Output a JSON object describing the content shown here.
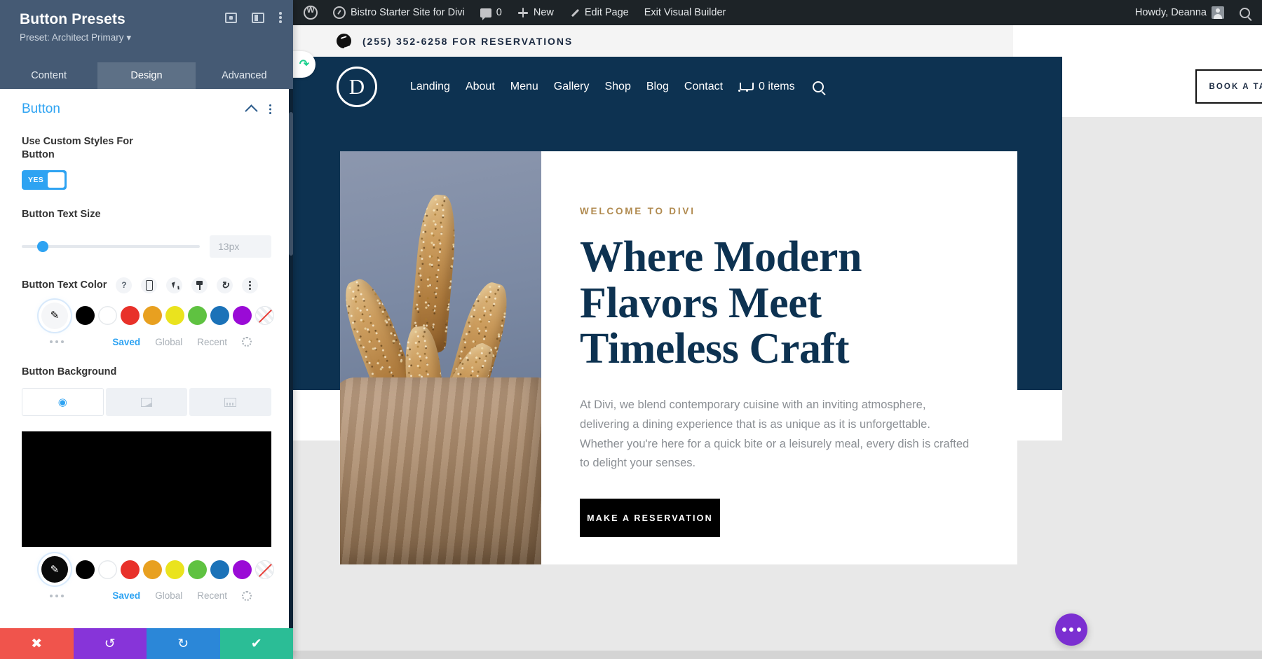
{
  "admin_bar": {
    "items": [
      {
        "name": "wordpress-logo",
        "label": ""
      },
      {
        "name": "site-name",
        "label": "Bistro Starter Site for Divi"
      },
      {
        "name": "comments",
        "label": "0"
      },
      {
        "name": "new",
        "label": "New"
      },
      {
        "name": "edit-page",
        "label": "Edit Page"
      },
      {
        "name": "exit-visual-builder",
        "label": "Exit Visual Builder"
      }
    ],
    "greeting": "Howdy, Deanna"
  },
  "site": {
    "phone_bar": "(255) 352-6258 FOR RESERVATIONS",
    "logo_letter": "D",
    "nav": [
      "Landing",
      "About",
      "Menu",
      "Gallery",
      "Shop",
      "Blog",
      "Contact"
    ],
    "cart_count": "0 items",
    "book_button": "BOOK A TABLE",
    "hero": {
      "eyebrow": "WELCOME TO DIVI",
      "heading": "Where Modern Flavors Meet Timeless Craft",
      "paragraph": "At Divi, we blend contemporary cuisine with an inviting atmosphere, delivering a dining experience that is as unique as it is unforgettable. Whether you're here for a quick bite or a leisurely meal, every dish is crafted to delight your senses.",
      "cta": "MAKE A RESERVATION"
    }
  },
  "panel": {
    "title": "Button Presets",
    "preset_label": "Preset: Architect Primary",
    "tabs": [
      {
        "label": "Content",
        "active": false
      },
      {
        "label": "Design",
        "active": true
      },
      {
        "label": "Advanced",
        "active": false
      }
    ],
    "section": {
      "title": "Button",
      "use_custom_styles_label": "Use Custom Styles For Button",
      "toggle_value": "YES",
      "text_size_label": "Button Text Size",
      "text_size_value": "13px",
      "text_color_label": "Button Text Color",
      "background_label": "Button Background",
      "palette": [
        {
          "name": "black",
          "hex": "#000000"
        },
        {
          "name": "white",
          "hex": "#ffffff"
        },
        {
          "name": "red",
          "hex": "#e8312a"
        },
        {
          "name": "orange",
          "hex": "#e8a020"
        },
        {
          "name": "yellow",
          "hex": "#eae31e"
        },
        {
          "name": "green",
          "hex": "#5fc241"
        },
        {
          "name": "blue",
          "hex": "#1b72b8"
        },
        {
          "name": "purple",
          "hex": "#9a0bd6"
        },
        {
          "name": "transparent",
          "hex": "none"
        }
      ],
      "color_tabs": [
        {
          "label": "Saved",
          "active": true
        },
        {
          "label": "Global",
          "active": false
        },
        {
          "label": "Recent",
          "active": false
        }
      ],
      "accent_blue": "#2ea3f2",
      "selected_background": "#000000"
    },
    "actions": [
      {
        "name": "cancel",
        "glyph": "✖",
        "color": "#f0544c"
      },
      {
        "name": "undo",
        "glyph": "↺",
        "color": "#8734d9"
      },
      {
        "name": "redo",
        "glyph": "↻",
        "color": "#2b87d8"
      },
      {
        "name": "save",
        "glyph": "✔",
        "color": "#2bbd96"
      }
    ]
  }
}
